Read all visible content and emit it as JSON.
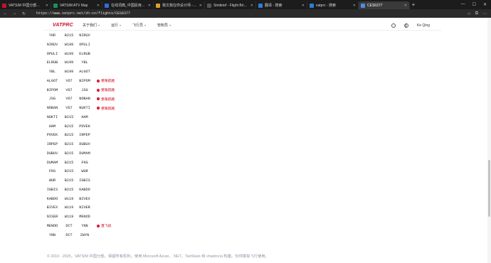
{
  "browser": {
    "tabs": [
      {
        "label": "VATSIM 中国分部站点",
        "favicon_color": "#c8102e",
        "active": false
      },
      {
        "label": "VATSIM ATV Map",
        "favicon_color": "#1a8f5a",
        "active": false
      },
      {
        "label": "在线词典_中国民用航空局",
        "favicon_color": "#2f6fd8",
        "active": false
      },
      {
        "label": "我文我在你设计师 - 飞行员",
        "favicon_color": "#e0a02a",
        "active": false
      },
      {
        "label": "Simbrief - Flight Briefing",
        "favicon_color": "#555555",
        "active": false
      },
      {
        "label": "翻译 - 搜索",
        "favicon_color": "#2d7dd2",
        "active": false
      },
      {
        "label": "vatprc - 搜索",
        "favicon_color": "#2d7dd2",
        "active": false
      },
      {
        "label": "CES6377",
        "favicon_color": "#4a90d9",
        "active": true
      }
    ],
    "new_tab": "+",
    "window_controls": [
      "—",
      "☐",
      "✕"
    ],
    "nav_icons": [
      "←",
      "→",
      "↻"
    ],
    "url": "https://www.vatprc.net/zh-cn/flights/CES6377",
    "toolbar_icons": [
      "☆",
      "⧉",
      "⋯"
    ]
  },
  "site": {
    "logo_main": "VATPRC",
    "logo_suffix": "",
    "menu": [
      {
        "label": "关于我们"
      },
      {
        "label": "运行"
      },
      {
        "label": "飞行员"
      },
      {
        "label": "管制员"
      }
    ],
    "caret": "▾",
    "user_name": "Ke Qing"
  },
  "route": [
    {
      "from": "YHD",
      "via": "B215",
      "to": "NIRUV",
      "note": ""
    },
    {
      "from": "NIRUV",
      "via": "W199",
      "to": "OPULI",
      "note": ""
    },
    {
      "from": "OPULI",
      "via": "W199",
      "to": "ELRUB",
      "note": ""
    },
    {
      "from": "ELRUB",
      "via": "W199",
      "to": "YBL",
      "note": ""
    },
    {
      "from": "YBL",
      "via": "W199",
      "to": "ALGOT",
      "note": ""
    },
    {
      "from": "ALGOT",
      "via": "V67",
      "to": "BIPOM",
      "note": "受限航路"
    },
    {
      "from": "BIPOM",
      "via": "V67",
      "to": "JSG",
      "note": "受限航路"
    },
    {
      "from": "JSG",
      "via": "V67",
      "to": "NOBAN",
      "note": "受限航路"
    },
    {
      "from": "NOBAN",
      "via": "V67",
      "to": "NUKTI",
      "note": "受限航路"
    },
    {
      "from": "NUKTI",
      "via": "B215",
      "to": "HAM",
      "note": ""
    },
    {
      "from": "HAM",
      "via": "B215",
      "to": "POVEK",
      "note": ""
    },
    {
      "from": "POVEK",
      "via": "B215",
      "to": "IRPEP",
      "note": ""
    },
    {
      "from": "IRPEP",
      "via": "B215",
      "to": "DUBUV",
      "note": ""
    },
    {
      "from": "DUBUV",
      "via": "B215",
      "to": "DUMAM",
      "note": ""
    },
    {
      "from": "DUMAM",
      "via": "B215",
      "to": "FKG",
      "note": ""
    },
    {
      "from": "FKG",
      "via": "B215",
      "to": "WUR",
      "note": ""
    },
    {
      "from": "WUR",
      "via": "B215",
      "to": "IGBIS",
      "note": ""
    },
    {
      "from": "IGBIS",
      "via": "B215",
      "to": "KABDO",
      "note": ""
    },
    {
      "from": "KABDO",
      "via": "W119",
      "to": "BIVEX",
      "note": ""
    },
    {
      "from": "BIVEX",
      "via": "W119",
      "to": "NIXER",
      "note": ""
    },
    {
      "from": "NIXER",
      "via": "W119",
      "to": "MENOD",
      "note": ""
    },
    {
      "from": "MENOD",
      "via": "DCT",
      "to": "YNN",
      "note": "直飞段"
    },
    {
      "from": "YNN",
      "via": "DCT",
      "to": "ZWYN",
      "note": ""
    }
  ],
  "note_icon": "!",
  "footer": "© 2010 - 2025，VATSIM 中国分部。保留所有权利。使用 Microsoft Azure、.NET、TanStack 和 shadcn/ui 构建。仅供模拟飞行使用。",
  "colors": {
    "accent": "#c8102e",
    "warning": "#d0021b"
  }
}
